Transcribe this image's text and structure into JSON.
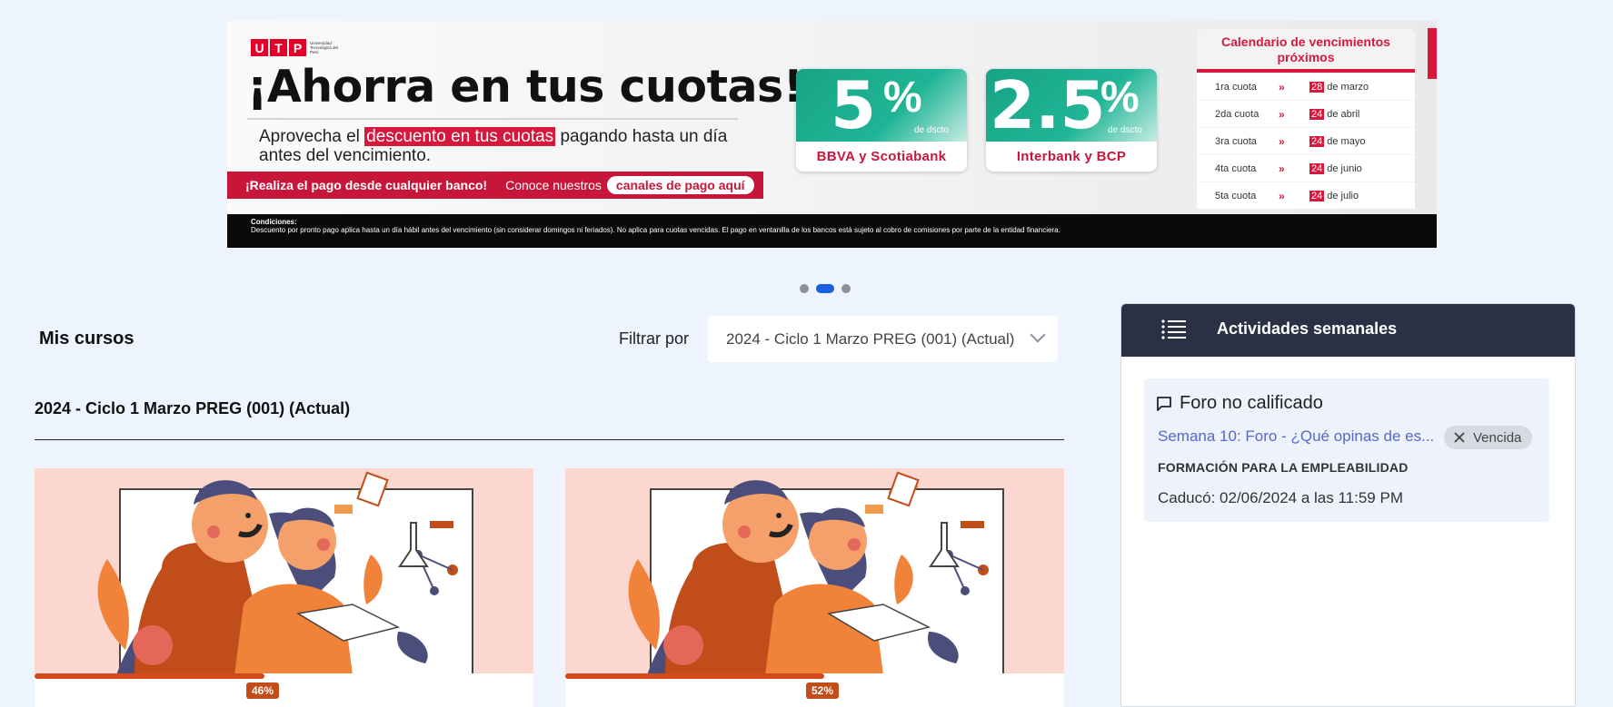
{
  "banner": {
    "logo_text": "UTP",
    "logo_letters": [
      "U",
      "T",
      "P"
    ],
    "logo_sub": "Universidad Tecnológica del Perú",
    "headline": "¡Ahorra en tus cuotas!",
    "sub_before": "Aprovecha el ",
    "sub_highlight": "descuento en tus cuotas",
    "sub_after": " pagando hasta un día antes del vencimiento.",
    "strip_text": "¡Realiza el pago desde cualquier banco!",
    "strip_link_prefix": "Conoce nuestros",
    "strip_link": "canales de pago aquí",
    "promos": [
      {
        "value": "5",
        "pct": "%",
        "dscto": "de dscto",
        "banks": "BBVA y Scotiabank"
      },
      {
        "value": "2.5",
        "pct": "%",
        "dscto": "de dscto",
        "banks": "Interbank y BCP"
      }
    ],
    "calendar_title": "Calendario de vencimientos próximos",
    "calendar_rows": [
      {
        "cuota": "1ra cuota",
        "day": "28",
        "month": "de marzo"
      },
      {
        "cuota": "2da cuota",
        "day": "24",
        "month": "de abril"
      },
      {
        "cuota": "3ra cuota",
        "day": "24",
        "month": "de mayo"
      },
      {
        "cuota": "4ta cuota",
        "day": "24",
        "month": "de junio"
      },
      {
        "cuota": "5ta cuota",
        "day": "24",
        "month": "de julio"
      }
    ],
    "conditions_title": "Condiciones:",
    "conditions_text": "Descuento por pronto pago aplica hasta un día hábil antes del vencimiento (sin considerar domingos ni feriados). No aplica para cuotas vencidas. El pago en ventanilla de los bancos está sujeto al cobro de comisiones por parte de la entidad financiera."
  },
  "carousel": {
    "count": 3,
    "active_index": 1
  },
  "courses": {
    "title": "Mis cursos",
    "filter_label": "Filtrar por",
    "filter_value": "2024 - Ciclo 1 Marzo PREG (001) (Actual)",
    "period_heading": "2024 - Ciclo 1 Marzo PREG (001) (Actual)",
    "cards": [
      {
        "progress": 46,
        "progress_label": "46%"
      },
      {
        "progress": 52,
        "progress_label": "52%"
      }
    ]
  },
  "activities": {
    "title": "Actividades semanales",
    "items": [
      {
        "type": "Foro no calificado",
        "link": "Semana 10: Foro - ¿Qué opinas de es...",
        "status": "Vencida",
        "course": "FORMACIÓN PARA LA EMPLEABILIDAD",
        "due": "Caducó: 02/06/2024 a las 11:59 PM"
      }
    ]
  },
  "colors": {
    "page_bg": "#edf4fd",
    "utp_red": "#d5183b",
    "promo_green": "#17a385",
    "accent_blue": "#1a5fe0",
    "panel_header": "#2b3144",
    "progress_orange": "#d3491b"
  },
  "icons": {
    "list": "list-icon",
    "comment": "comment-icon",
    "close": "close-icon",
    "chevron": "chevron-down-icon",
    "arrow": "double-chevron-right-icon"
  }
}
